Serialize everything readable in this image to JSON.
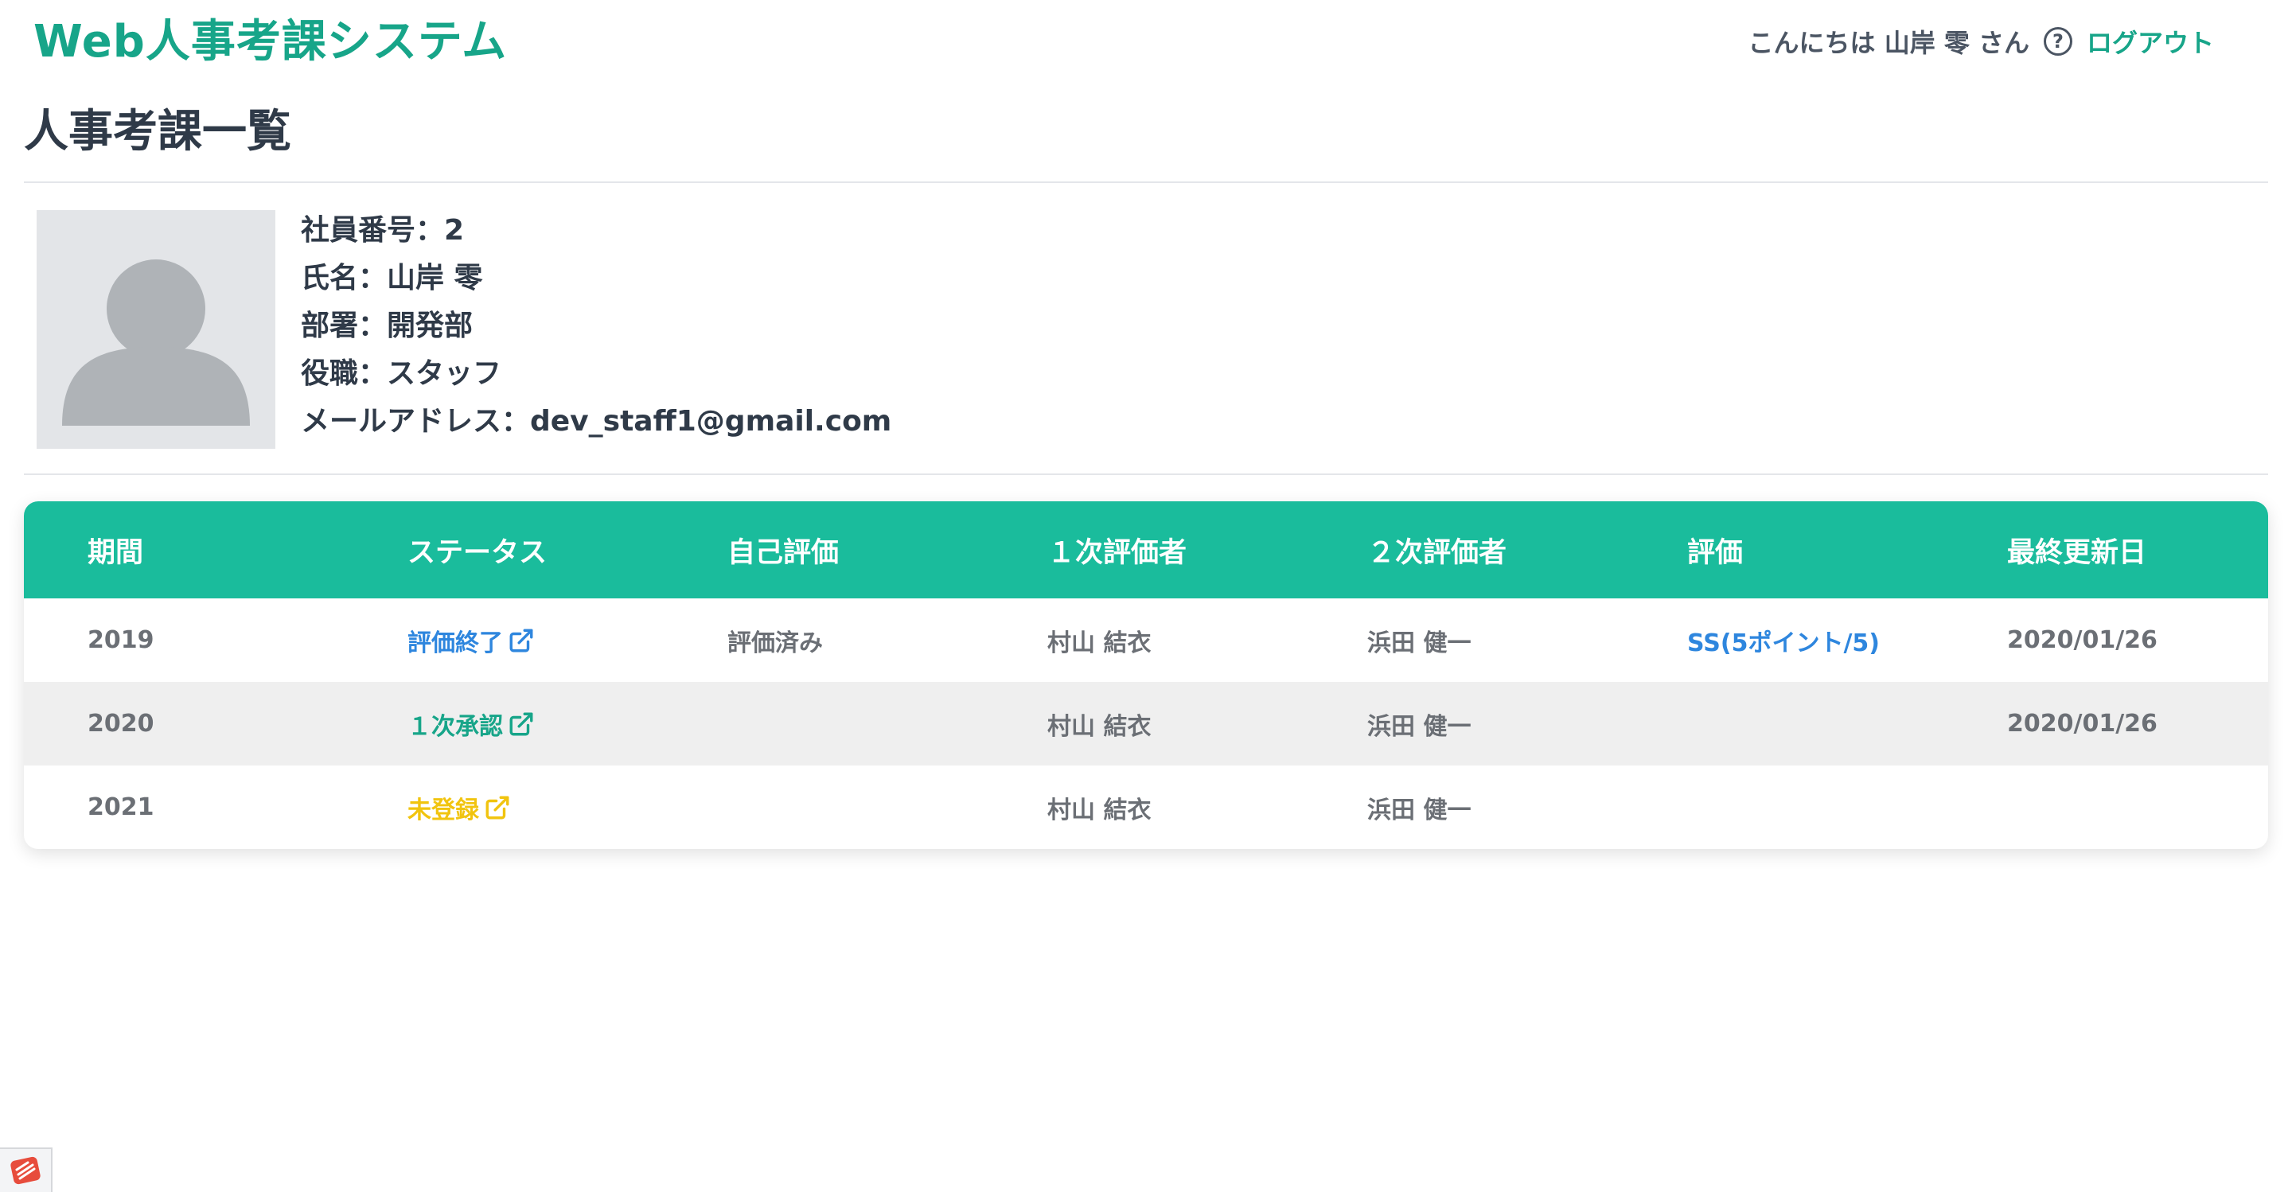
{
  "header": {
    "app_title": "Web人事考課システム",
    "greeting": "こんにちは 山岸 零 さん",
    "help_icon": "question-circle-icon",
    "logout_label": "ログアウト"
  },
  "page": {
    "heading": "人事考課一覧"
  },
  "profile": {
    "avatar_icon": "user-avatar-placeholder",
    "employee_no": "社員番号：2",
    "name": "氏名：山岸 零",
    "department": "部署：開発部",
    "position": "役職：スタッフ",
    "email": "メールアドレス：dev_staff1@gmail.com"
  },
  "table": {
    "columns": [
      "期間",
      "ステータス",
      "自己評価",
      "１次評価者",
      "２次評価者",
      "評価",
      "最終更新日"
    ],
    "rows": [
      {
        "period": "2019",
        "status": "評価終了",
        "status_color": "#2e86de",
        "self_eval": "評価済み",
        "evaluator1": "村山 結衣",
        "evaluator2": "浜田 健一",
        "rating": "SS(5ポイント/5)",
        "updated": "2020/01/26"
      },
      {
        "period": "2020",
        "status": "１次承認",
        "status_color": "#17a589",
        "self_eval": "",
        "evaluator1": "村山 結衣",
        "evaluator2": "浜田 健一",
        "rating": "",
        "updated": "2020/01/26"
      },
      {
        "period": "2021",
        "status": "未登録",
        "status_color": "#f1c40f",
        "self_eval": "",
        "evaluator1": "村山 結衣",
        "evaluator2": "浜田 健一",
        "rating": "",
        "updated": ""
      }
    ]
  },
  "colors": {
    "brand": "#17a589",
    "table_header": "#1abc9c",
    "link_blue": "#2e86de",
    "warning_yellow": "#f1c40f"
  }
}
